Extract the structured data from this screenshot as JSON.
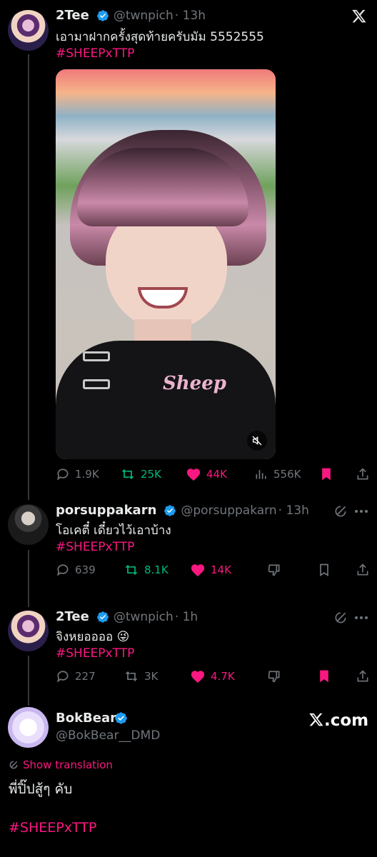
{
  "brand": {
    "x_logo": "x-logo-icon",
    "xcom_label": ".com",
    "colors": {
      "accent": "#f91880",
      "verified": "#1d9bf0",
      "retweet": "#00ba7c",
      "muted": "#71767b"
    }
  },
  "tweets": [
    {
      "name": "2Tee",
      "handle": "@twnpich",
      "time": "· 13h",
      "text": "เอามาฝากครั้งสุดท้ายครับมัม 5552555",
      "hashtag": "#SHEEPxTTP",
      "media_text": "Sheep",
      "stats": {
        "replies": "1.9K",
        "retweets": "25K",
        "likes": "44K",
        "views": "556K"
      }
    },
    {
      "name": "porsuppakarn",
      "handle": "@porsuppakarn",
      "time": "· 13h",
      "text": "โอเคตี๋ เดี๋ยวไว้เอาบ้าง",
      "hashtag": "#SHEEPxTTP",
      "stats": {
        "replies": "639",
        "retweets": "8.1K",
        "likes": "14K"
      }
    },
    {
      "name": "2Tee",
      "handle": "@twnpich",
      "time": "· 1h",
      "text": "จิงหยออออ 😜",
      "hashtag": "#SHEEPxTTP",
      "stats": {
        "replies": "227",
        "retweets": "3K",
        "likes": "4.7K"
      }
    }
  ],
  "quote": {
    "name": "BokBear",
    "handle": "@BokBear__DMD",
    "show_translation": "Show translation",
    "text": "พี่ปิ๊ปสู้ๆ คับ",
    "hashtag": "#SHEEPxTTP"
  }
}
